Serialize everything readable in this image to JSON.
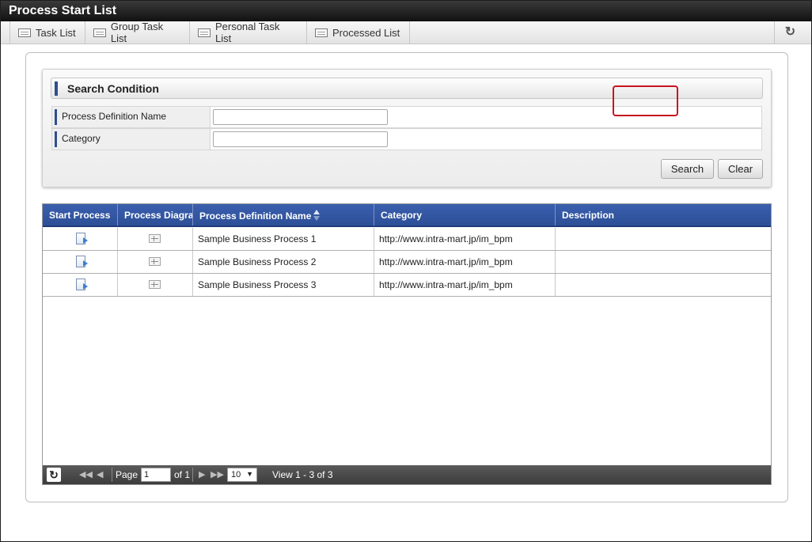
{
  "window": {
    "title": "Process Start List"
  },
  "tabs": [
    {
      "label": "Task List"
    },
    {
      "label": "Group Task List"
    },
    {
      "label": "Personal Task List"
    },
    {
      "label": "Processed List"
    }
  ],
  "search": {
    "header": "Search Condition",
    "fields": [
      {
        "label": "Process Definition Name",
        "value": ""
      },
      {
        "label": "Category",
        "value": ""
      }
    ],
    "search_label": "Search",
    "clear_label": "Clear"
  },
  "grid": {
    "columns": [
      "Start Process",
      "Process Diagram",
      "Process Definition Name",
      "Category",
      "Description"
    ],
    "rows": [
      {
        "name": "Sample Business Process 1",
        "category": "http://www.intra-mart.jp/im_bpm",
        "description": ""
      },
      {
        "name": "Sample Business Process 2",
        "category": "http://www.intra-mart.jp/im_bpm",
        "description": ""
      },
      {
        "name": "Sample Business Process 3",
        "category": "http://www.intra-mart.jp/im_bpm",
        "description": ""
      }
    ]
  },
  "pager": {
    "page_label": "Page",
    "page_value": "1",
    "of_label": "of 1",
    "page_size": "10",
    "view_text": "View 1 - 3 of 3"
  },
  "icons": {
    "tab": "list-icon",
    "refresh": "refresh-icon",
    "start": "start-process-icon",
    "diagram": "process-diagram-icon"
  },
  "colors": {
    "header_blue": "#2d4f97",
    "highlight_red": "#c8141e",
    "titlebar": "#111111"
  }
}
